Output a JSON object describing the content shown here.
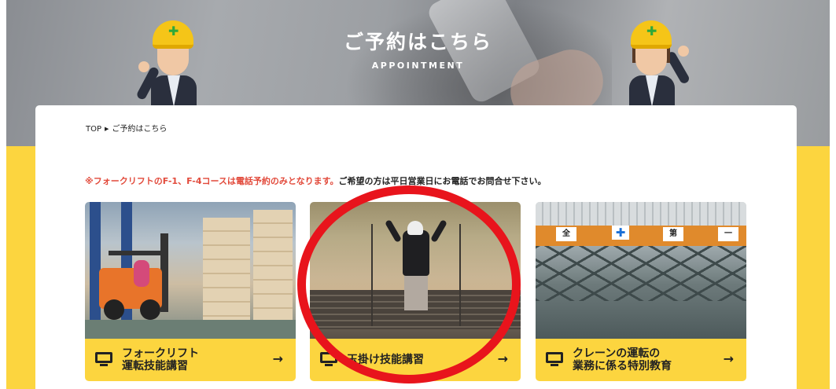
{
  "hero": {
    "title": "ご予約はこちら",
    "subtitle": "APPOINTMENT"
  },
  "breadcrumb": {
    "home": "TOP",
    "separator": "▶",
    "current": "ご予約はこちら"
  },
  "notice": {
    "red_text": "※フォークリフトのF-1、F-4コースは電話予約のみとなります。",
    "black_text": "ご希望の方は平日営業日にお電話でお問合せ下さい。"
  },
  "courses": [
    {
      "lines": [
        "フォークリフト",
        "運転技能講習"
      ],
      "icon": "computer-icon",
      "arrow": "→"
    },
    {
      "lines": [
        "玉掛け技能講習"
      ],
      "icon": "computer-icon",
      "arrow": "→"
    },
    {
      "lines": [
        "クレーンの運転の",
        "業務に係る特別教育"
      ],
      "icon": "computer-icon",
      "arrow": "→"
    }
  ],
  "crane_photo_signs": [
    "全",
    "第",
    "一"
  ],
  "colors": {
    "accent_yellow": "#fcd53f",
    "notice_red": "#e24a3b",
    "annotation_circle": "#e8141c"
  }
}
